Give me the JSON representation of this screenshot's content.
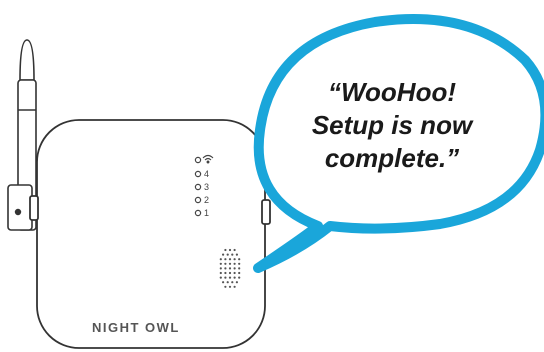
{
  "speech_bubble": {
    "lines": [
      "“WooHoo!",
      "Setup is now",
      "complete.”"
    ]
  },
  "device": {
    "brand": "NIGHT OWL",
    "indicator_labels": [
      "4",
      "3",
      "2",
      "1"
    ],
    "wifi_icon": "wifi-icon"
  },
  "colors": {
    "bubble_stroke": "#1aa6da",
    "device_outline": "#333333"
  }
}
